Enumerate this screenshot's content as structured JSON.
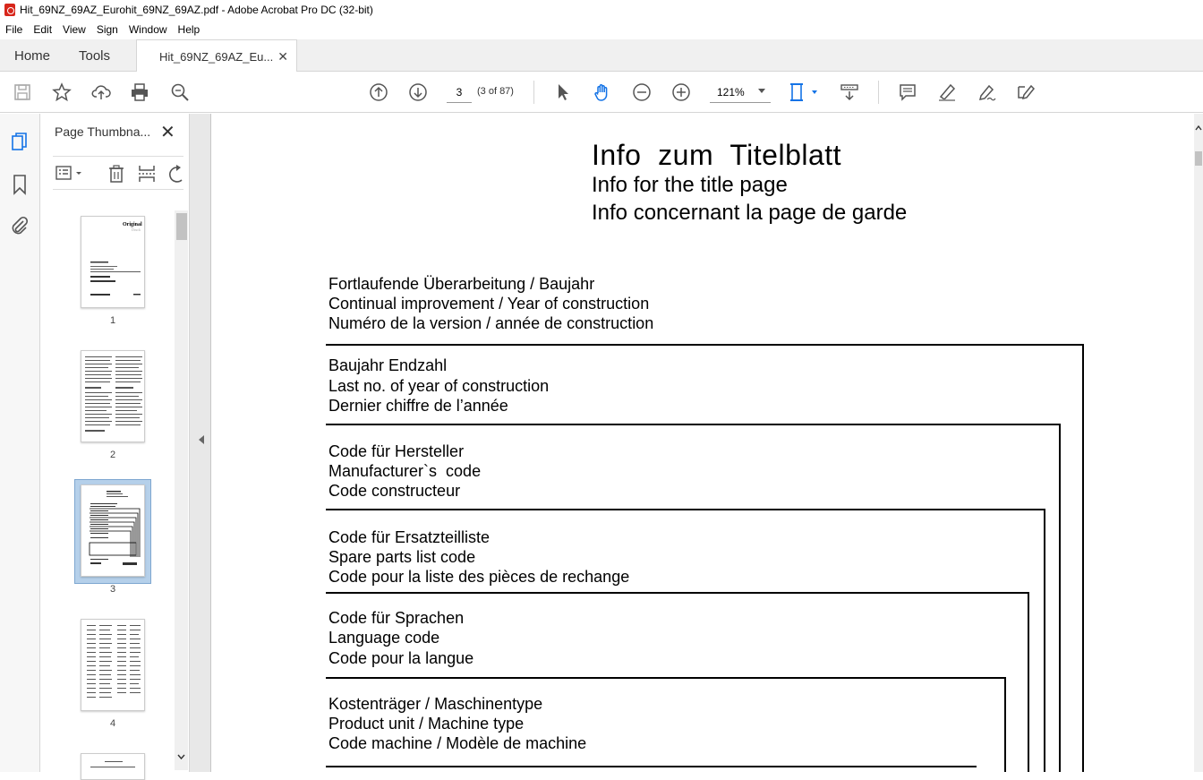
{
  "window": {
    "title": "Hit_69NZ_69AZ_Eurohit_69NZ_69AZ.pdf - Adobe Acrobat Pro DC (32-bit)"
  },
  "menu": [
    "File",
    "Edit",
    "View",
    "Sign",
    "Window",
    "Help"
  ],
  "tabs": {
    "home": "Home",
    "tools": "Tools",
    "document": "Hit_69NZ_69AZ_Eu..."
  },
  "toolbar": {
    "page_value": "3",
    "page_count": "(3 of 87)",
    "zoom": "121%"
  },
  "thumbnails": {
    "title": "Page Thumbna...",
    "pages": [
      "1",
      "2",
      "3",
      "4"
    ],
    "selected_page": "3"
  },
  "document": {
    "title_de": "Info  zum  Titelblatt",
    "title_en": "Info for the title page",
    "title_fr": "Info concernant la page de garde",
    "sections": [
      {
        "de": "Fortlaufende Überarbeitung / Baujahr",
        "en": "Continual improvement / Year of construction",
        "fr": "Numéro de la version / année de construction"
      },
      {
        "de": "Baujahr Endzahl",
        "en": "Last no. of year of construction",
        "fr": "Dernier chiffre de l’année"
      },
      {
        "de": "Code für Hersteller",
        "en": "Manufacturer`s  code",
        "fr": "Code constructeur"
      },
      {
        "de": "Code für Ersatzteilliste",
        "en": "Spare parts list code",
        "fr": "Code pour la liste des pièces de rechange"
      },
      {
        "de": "Code für Sprachen",
        "en": "Language code",
        "fr": "Code pour la langue"
      },
      {
        "de": "Kostenträger / Maschinentype",
        "en": "Product unit / Machine type",
        "fr": "Code machine / Modèle de machine"
      }
    ]
  }
}
